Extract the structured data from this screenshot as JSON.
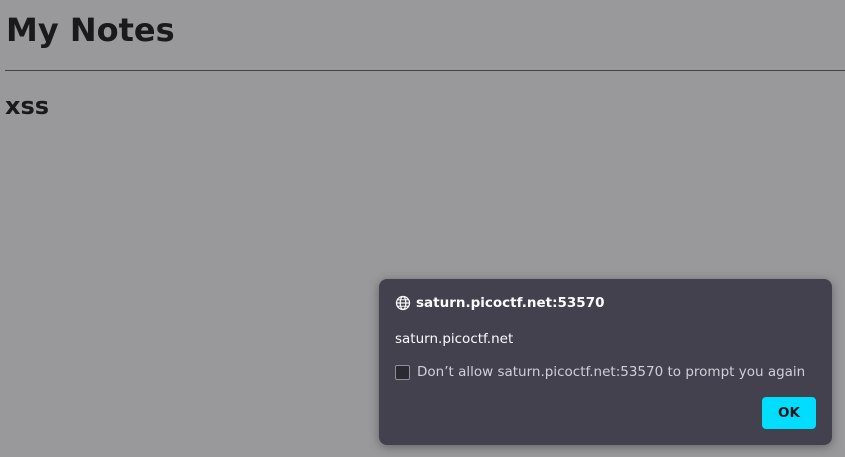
{
  "page": {
    "title": "My Notes",
    "note_title": "xss"
  },
  "dialog": {
    "origin": "saturn.picoctf.net:53570",
    "origin_icon": "globe-icon",
    "message": "saturn.picoctf.net",
    "checkbox_label": "Don’t allow saturn.picoctf.net:53570 to prompt you again",
    "checkbox_checked": false,
    "ok_label": "OK"
  },
  "colors": {
    "dialog_background": "#42414d",
    "ok_button": "#00ddff",
    "overlay": "#999999"
  }
}
